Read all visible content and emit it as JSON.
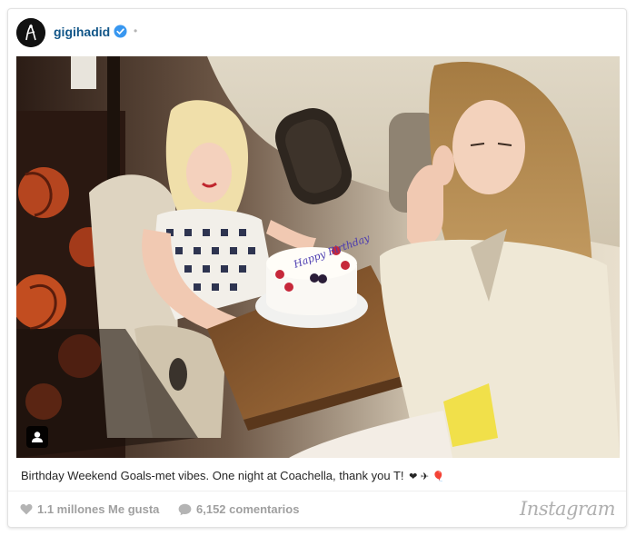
{
  "post": {
    "username": "gigihadid",
    "verified_icon": "verified-badge-icon",
    "separator": "•",
    "caption": "Birthday Weekend Goals-met vibes. One night at Coachella, thank you T!",
    "caption_emoji": "❤ ✈ 🎈",
    "likes": "1.1 millones Me gusta",
    "comments": "6,152 comentarios",
    "brand": "Instagram"
  },
  "colors": {
    "username": "#125688",
    "verified": "#3897f0",
    "meta": "#a0a0a0"
  },
  "photo": {
    "cake_text": "Happy Birthday"
  }
}
